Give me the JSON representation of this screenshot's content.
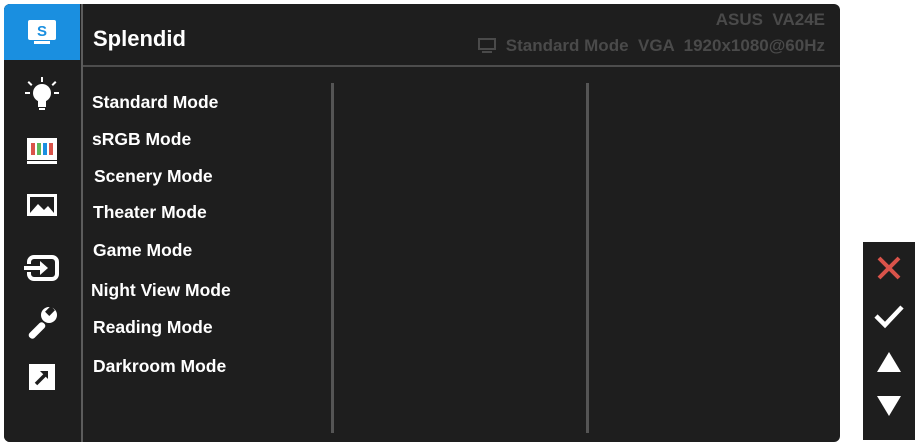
{
  "header": {
    "title": "Splendid",
    "model": "ASUS  VA24E",
    "status": "Standard Mode  VGA  1920x1080@60Hz"
  },
  "sidebar": {
    "items": [
      {
        "name": "splendid",
        "icon": "splendid-s-icon",
        "active": true
      },
      {
        "name": "blue-light-filter",
        "icon": "bulb-icon"
      },
      {
        "name": "color",
        "icon": "color-bars-icon"
      },
      {
        "name": "image",
        "icon": "landscape-image-icon"
      },
      {
        "name": "input-select",
        "icon": "input-arrow-icon"
      },
      {
        "name": "system-setup",
        "icon": "wrench-icon"
      },
      {
        "name": "shortcut",
        "icon": "shortcut-arrow-icon"
      }
    ]
  },
  "menu": {
    "items": [
      "Standard Mode",
      "sRGB Mode",
      "Scenery Mode",
      "Theater Mode",
      "Game Mode",
      "Night View Mode",
      "Reading Mode",
      "Darkroom Mode"
    ]
  },
  "buttons": {
    "close_icon": "close-x-icon",
    "confirm_icon": "checkmark-icon",
    "up_icon": "triangle-up-icon",
    "down_icon": "triangle-down-icon"
  },
  "colors": {
    "accent": "#1a8fe0",
    "panel": "#1e1e1e",
    "close": "#d9534a",
    "text": "#ffffff",
    "dim_text": "#4a4a4a"
  }
}
